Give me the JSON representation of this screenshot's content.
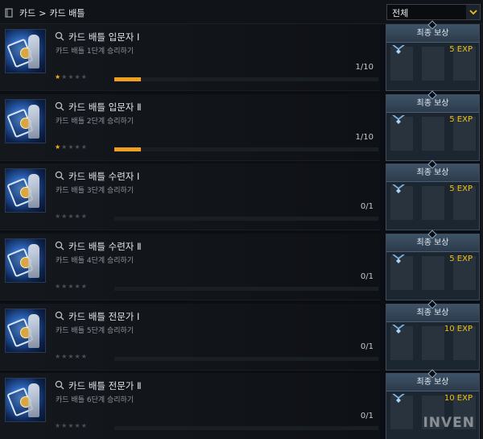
{
  "header": {
    "breadcrumb_root": "카드",
    "breadcrumb_sep": ">",
    "breadcrumb_current": "카드 배틀",
    "filter_value": "전체"
  },
  "reward_label": "최종 보상",
  "colors": {
    "accent": "#f0a020",
    "star_on": "#f0b21a",
    "exp": "#f1c20e"
  },
  "achievements": [
    {
      "title": "카드 배틀 입문자 Ⅰ",
      "description": "카드 배틀 1단계 승리하기",
      "stars_filled": 1,
      "stars_total": 5,
      "progress": "1/10",
      "progress_fraction": 0.1,
      "reward": "5 EXP"
    },
    {
      "title": "카드 배틀 입문자 Ⅱ",
      "description": "카드 배틀 2단계 승리하기",
      "stars_filled": 1,
      "stars_total": 5,
      "progress": "1/10",
      "progress_fraction": 0.1,
      "reward": "5 EXP"
    },
    {
      "title": "카드 배틀 수련자 Ⅰ",
      "description": "카드 배틀 3단계 승리하기",
      "stars_filled": 0,
      "stars_total": 5,
      "progress": "0/1",
      "progress_fraction": 0,
      "reward": "5 EXP"
    },
    {
      "title": "카드 배틀 수련자 Ⅱ",
      "description": "카드 배틀 4단계 승리하기",
      "stars_filled": 0,
      "stars_total": 5,
      "progress": "0/1",
      "progress_fraction": 0,
      "reward": "5 EXP"
    },
    {
      "title": "카드 배틀 전문가 Ⅰ",
      "description": "카드 배틀 5단계 승리하기",
      "stars_filled": 0,
      "stars_total": 5,
      "progress": "0/1",
      "progress_fraction": 0,
      "reward": "10 EXP"
    },
    {
      "title": "카드 배틀 전문가 Ⅱ",
      "description": "카드 배틀 6단계 승리하기",
      "stars_filled": 0,
      "stars_total": 5,
      "progress": "0/1",
      "progress_fraction": 0,
      "reward": "10 EXP"
    }
  ],
  "watermark": "INVEN"
}
